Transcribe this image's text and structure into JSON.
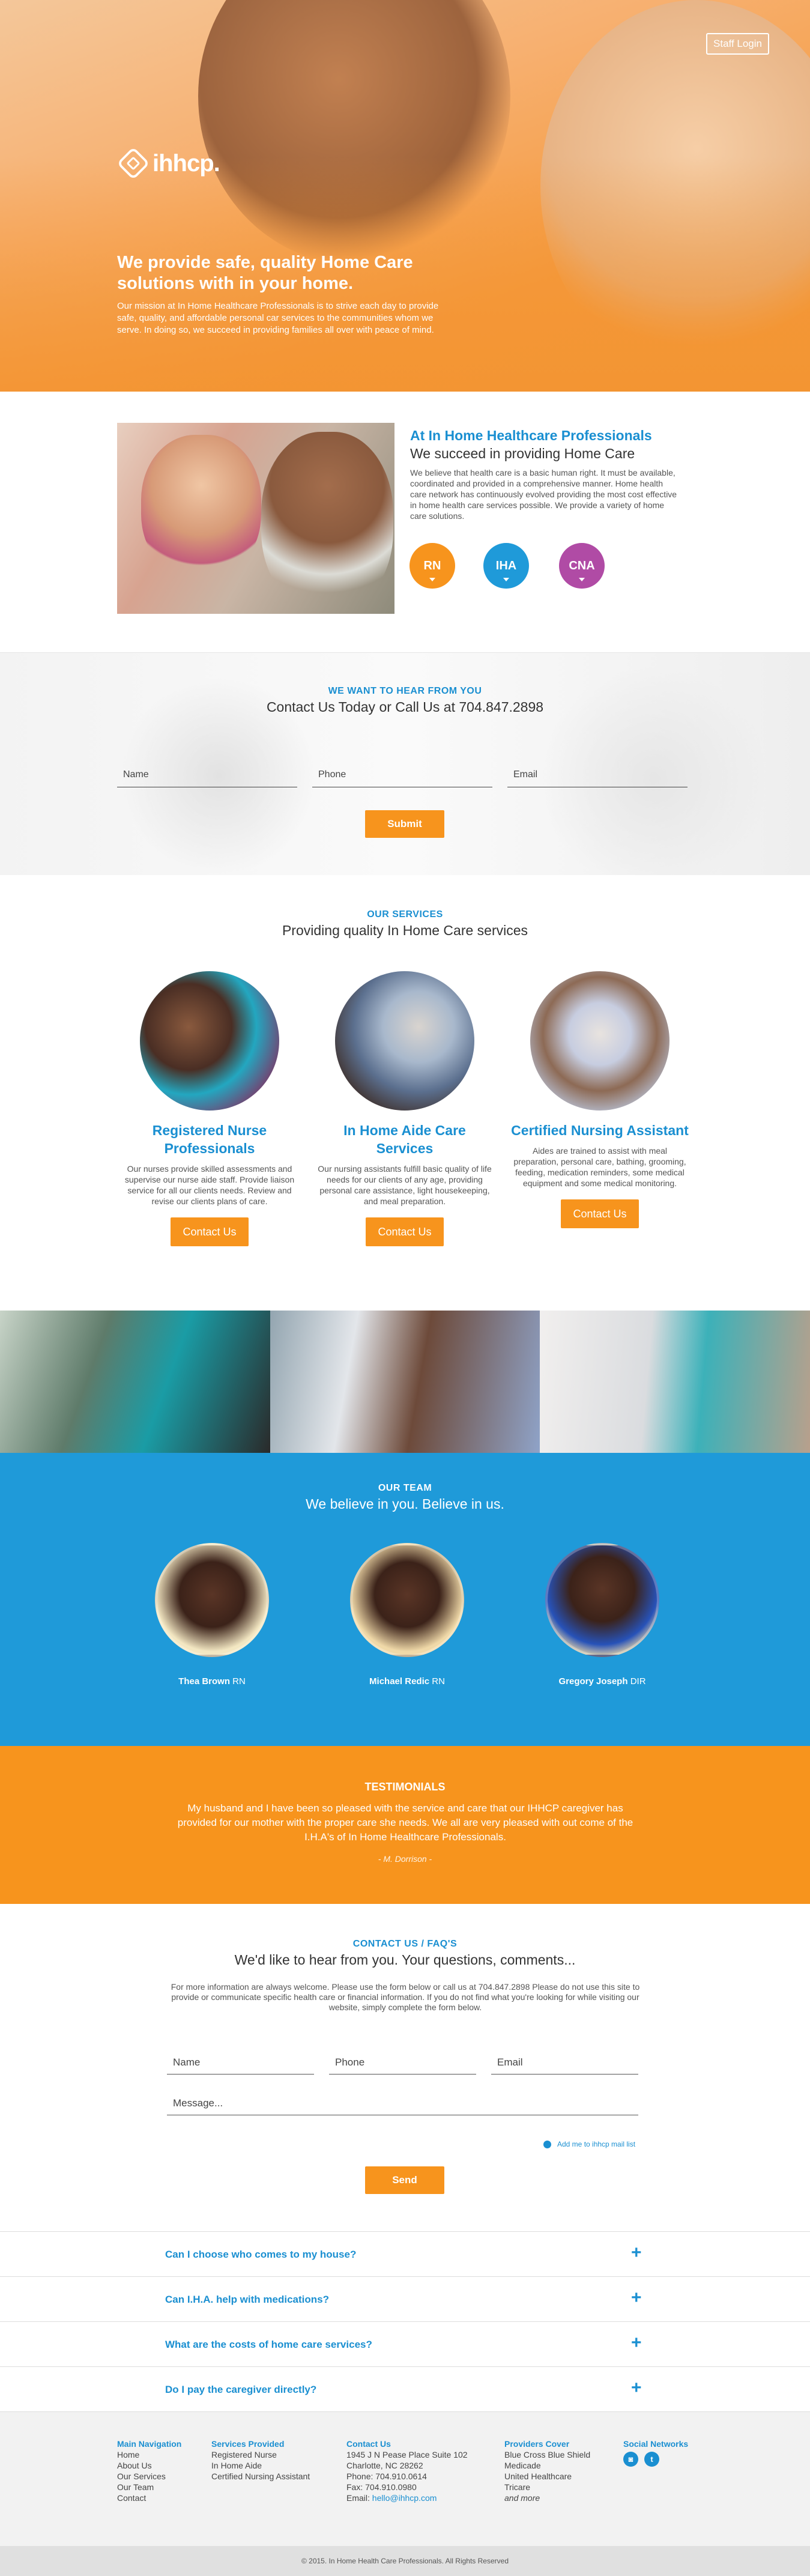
{
  "hero": {
    "staff_login": "Staff Login",
    "logo_text": "ihhcp.",
    "headline": "We provide safe, quality Home Care solutions with in your home.",
    "mission": "Our mission at In Home Healthcare Professionals is to strive each day to provide safe, quality, and affordable personal car services to the communities whom we serve. In doing so, we succeed in providing families all over with peace of mind."
  },
  "about": {
    "title": "At In Home Healthcare Professionals",
    "subtitle": "We succeed in providing Home Care",
    "description": "We believe that health care is a basic human right. It must be available, coordinated and provided in a comprehensive manner. Home health care network has continuously evolved providing the most cost effective in home health care services possible. We provide a variety of home care solutions.",
    "badges": [
      {
        "label": "RN",
        "color": "#f7941d"
      },
      {
        "label": "IHA",
        "color": "#1f9ad9"
      },
      {
        "label": "CNA",
        "color": "#b04ba5"
      }
    ]
  },
  "contact_band": {
    "eyebrow": "WE WANT TO HEAR FROM YOU",
    "headline": "Contact Us Today or Call Us at 704.847.2898",
    "name_placeholder": "Name",
    "phone_placeholder": "Phone",
    "email_placeholder": "Email",
    "submit": "Submit"
  },
  "services": {
    "eyebrow": "OUR SERVICES",
    "headline": "Providing quality In Home Care services",
    "items": [
      {
        "title": "Registered Nurse Professionals",
        "text": "Our nurses provide skilled assessments and supervise our nurse aide staff. Provide liaison service for all our clients needs. Review and revise our clients plans of care.",
        "button": "Contact Us"
      },
      {
        "title": "In Home Aide Care Services",
        "text": "Our nursing assistants fulfill basic quality of life needs for our clients of any age, providing personal care assistance, light housekeeping, and meal preparation.",
        "button": "Contact Us"
      },
      {
        "title": "Certified Nursing Assistant",
        "text": "Aides are trained to assist with meal preparation, personal care, bathing, grooming, feeding, medication reminders, some medical equipment and some medical monitoring.",
        "button": "Contact Us"
      }
    ]
  },
  "team": {
    "eyebrow": "OUR TEAM",
    "headline": "We believe in you. Believe in us.",
    "members": [
      {
        "name": "Thea Brown",
        "role": "RN"
      },
      {
        "name": "Michael Redic",
        "role": "RN"
      },
      {
        "name": "Gregory Joseph",
        "role": "DIR"
      }
    ]
  },
  "testimonials": {
    "title": "TESTIMONIALS",
    "quote": "My husband and I have been so pleased with the service and care that our IHHCP caregiver has provided for our mother with the proper care she needs. We all are very pleased with out come of the I.H.A's of In Home Healthcare Professionals.",
    "author": "- M. Dorrison -"
  },
  "contact_form": {
    "eyebrow": "CONTACT US / FAQ'S",
    "headline": "We'd like to hear from you. Your questions, comments...",
    "info": "For more information are always welcome. Please use the form below or call us at 704.847.2898 Please do not use this site to provide or communicate specific health care or financial information. If you do not find what you're looking for while visiting our website, simply complete the form below.",
    "name_placeholder": "Name",
    "phone_placeholder": "Phone",
    "email_placeholder": "Email",
    "message_placeholder": "Message...",
    "mailing_list": "Add me to ihhcp mail list",
    "send": "Send"
  },
  "faq": [
    {
      "question": "Can I choose who comes to my house?"
    },
    {
      "question": "Can I.H.A. help with medications?"
    },
    {
      "question": "What are the costs of home care services?"
    },
    {
      "question": "Do I pay the caregiver directly?"
    }
  ],
  "footer": {
    "nav_title": "Main Navigation",
    "nav": [
      "Home",
      "About Us",
      "Our Services",
      "Our Team",
      "Contact"
    ],
    "services_title": "Services Provided",
    "services": [
      "Registered Nurse",
      "In Home Aide",
      "Certified Nursing Assistant"
    ],
    "contact_title": "Contact Us",
    "contact": [
      "1945 J N Pease Place Suite 102",
      "Charlotte, NC 28262",
      "Phone: 704.910.0614",
      "Fax: 704.910.0980"
    ],
    "email_label": "Email: ",
    "email": "hello@ihhcp.com",
    "providers_title": "Providers Cover",
    "providers": [
      "Blue Cross Blue Shield",
      "Medicade",
      "United Healthcare",
      "Tricare"
    ],
    "providers_more": "and more",
    "social_title": "Social Networks",
    "copyright": "© 2015. In Home Health Care Professionals. All Rights Reserved"
  }
}
